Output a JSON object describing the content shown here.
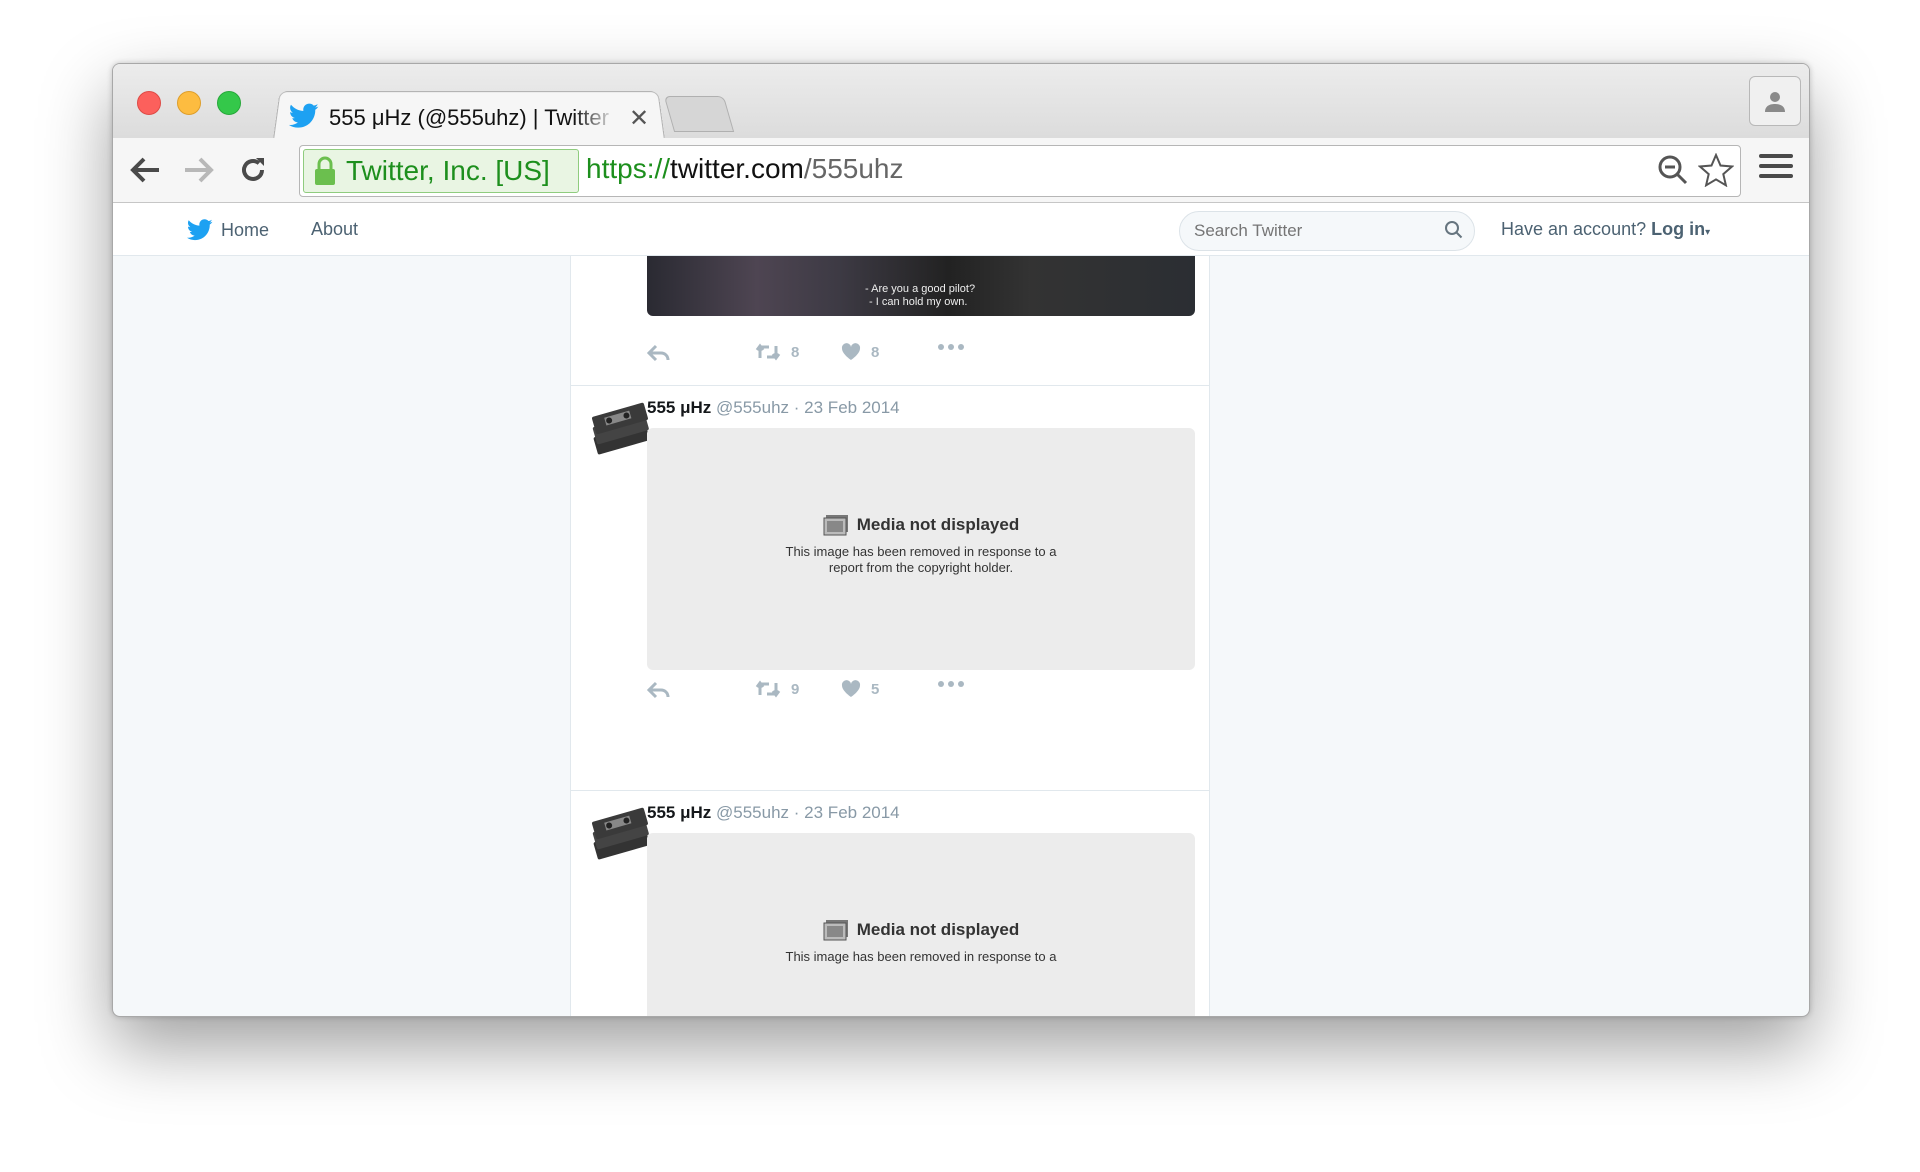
{
  "browser": {
    "tab_title": "555 μHz (@555uhz) | Twitter",
    "ev_label": "Twitter, Inc. [US]",
    "url_scheme": "https://",
    "url_host": "twitter.com",
    "url_path": "/555uhz"
  },
  "nav": {
    "home": "Home",
    "about": "About",
    "search_placeholder": "Search Twitter",
    "login_prefix": "Have an account?",
    "login_label": "Log in"
  },
  "tweets": [
    {
      "subtitle_line1": "- Are you a good pilot?",
      "subtitle_line2": "- I can hold my own.",
      "retweets": "8",
      "likes": "8"
    },
    {
      "name": "555 μHz",
      "handle": "@555uhz",
      "dot": "·",
      "date": "23 Feb 2014",
      "media_title": "Media not displayed",
      "media_text": "This image has been removed in response to a report from the copyright holder.",
      "retweets": "9",
      "likes": "5"
    },
    {
      "name": "555 μHz",
      "handle": "@555uhz",
      "dot": "·",
      "date": "23 Feb 2014",
      "media_title": "Media not displayed",
      "media_text": "This image has been removed in response to a"
    }
  ],
  "colors": {
    "accent": "#1da1f2",
    "ev_green": "#1d8f1d",
    "page_bg": "#f5f8fa"
  }
}
